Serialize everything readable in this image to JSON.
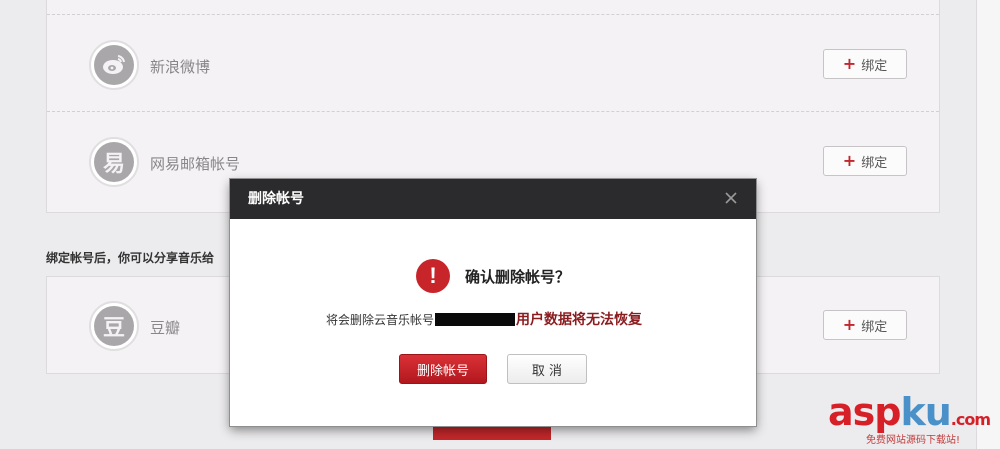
{
  "accounts": {
    "weibo": {
      "label": "新浪微博",
      "avatar_glyph": "",
      "icon": "weibo-icon",
      "bind_label": "绑定"
    },
    "mail": {
      "label": "网易邮箱帐号",
      "avatar_glyph": "易",
      "icon": "netease-icon",
      "bind_label": "绑定"
    },
    "douban": {
      "label": "豆瓣",
      "avatar_glyph": "豆",
      "icon": "douban-icon",
      "bind_label": "绑定"
    }
  },
  "hint": "绑定帐号后，你可以分享音乐给",
  "under_button_label": "",
  "dialog": {
    "title": "删除帐号",
    "confirm": "确认删除帐号？",
    "message_prefix": "将会删除云音乐帐号",
    "message_warning": "用户数据将无法恢复",
    "delete_label": "删除帐号",
    "cancel_label": "取 消"
  },
  "watermark": {
    "brand_a": "asp",
    "brand_b": "ku",
    "brand_c": ".com",
    "tagline": "免费网站源码下载站!"
  },
  "colors": {
    "accent_red": "#c8252b",
    "warning_text": "#8b1c1f",
    "dialog_header": "#2b2b2d"
  }
}
